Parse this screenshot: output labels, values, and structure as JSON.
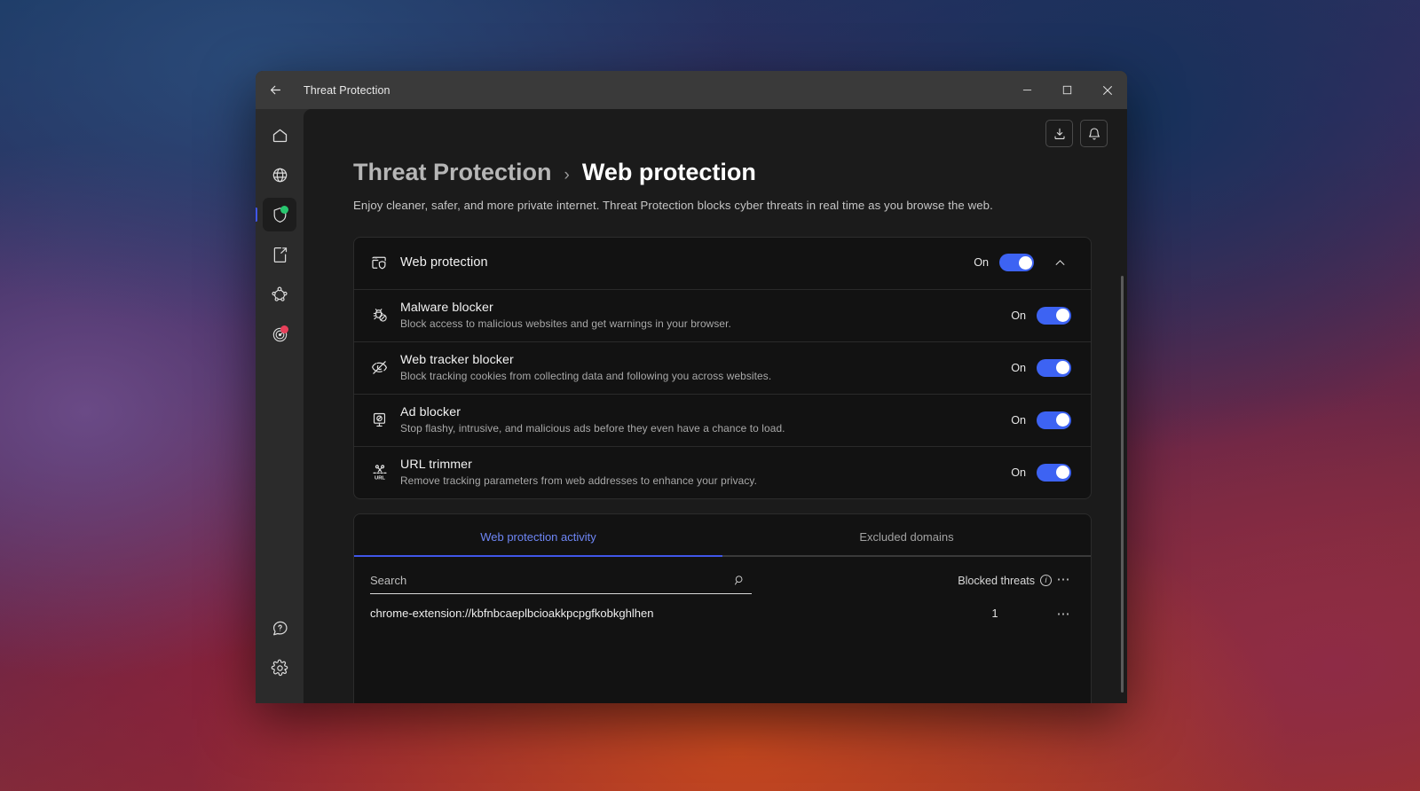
{
  "window": {
    "title": "Threat Protection",
    "back_icon": "arrow-left-icon",
    "minimize_label": "–",
    "maximize_label": "□",
    "close_label": "✕"
  },
  "rail": {
    "items": [
      {
        "name": "home",
        "icon": "home-icon",
        "active": false,
        "badge": ""
      },
      {
        "name": "vpn",
        "icon": "globe-icon",
        "active": false,
        "badge": ""
      },
      {
        "name": "threat-protection",
        "icon": "shield-icon",
        "active": true,
        "badge": "green"
      },
      {
        "name": "file-share",
        "icon": "file-share-icon",
        "active": false,
        "badge": ""
      },
      {
        "name": "meshnet",
        "icon": "meshnet-icon",
        "active": false,
        "badge": ""
      },
      {
        "name": "dark-web-monitor",
        "icon": "radar-icon",
        "active": false,
        "badge": "red"
      }
    ],
    "bottom_items": [
      {
        "name": "help",
        "icon": "help-icon"
      },
      {
        "name": "settings",
        "icon": "gear-icon"
      }
    ]
  },
  "top_actions": [
    {
      "name": "download-button",
      "icon": "download-icon"
    },
    {
      "name": "notifications-button",
      "icon": "bell-icon"
    }
  ],
  "header": {
    "breadcrumb_parent": "Threat Protection",
    "breadcrumb_separator": "›",
    "breadcrumb_current": "Web protection",
    "subtitle": "Enjoy cleaner, safer, and more private internet. Threat Protection blocks cyber threats in real time as you browse the web."
  },
  "master": {
    "icon": "browser-shield-icon",
    "title": "Web protection",
    "state_label": "On",
    "toggle_on": true,
    "collapse_icon": "chevron-up-icon"
  },
  "features": [
    {
      "icon": "bug-blocked-icon",
      "title": "Malware blocker",
      "description": "Block access to malicious websites and get warnings in your browser.",
      "state_label": "On",
      "toggle_on": true
    },
    {
      "icon": "eye-off-icon",
      "title": "Web tracker blocker",
      "description": "Block tracking cookies from collecting data and following you across websites.",
      "state_label": "On",
      "toggle_on": true
    },
    {
      "icon": "ad-blocked-icon",
      "title": "Ad blocker",
      "description": "Stop flashy, intrusive, and malicious ads before they even have a chance to load.",
      "state_label": "On",
      "toggle_on": true
    },
    {
      "icon": "url-scissors-icon",
      "title": "URL trimmer",
      "description": "Remove tracking parameters from web addresses to enhance your privacy.",
      "state_label": "On",
      "toggle_on": true
    }
  ],
  "activity": {
    "tabs": [
      {
        "label": "Web protection activity",
        "active": true
      },
      {
        "label": "Excluded domains",
        "active": false
      }
    ],
    "search": {
      "placeholder": "Search",
      "value": "",
      "icon": "search-icon"
    },
    "column_blocked_threats": "Blocked threats",
    "info_icon": "info-icon",
    "kebab_icon": "more-options-icon",
    "kebab_label": "⋯",
    "rows": [
      {
        "domain": "chrome-extension://kbfnbcaeplbcioakkpcpgfkobkghlhen",
        "blocked_threats": "1"
      }
    ]
  },
  "colors": {
    "accent_blue": "#3d63f3",
    "tab_active": "#6e86f5",
    "badge_green": "#28c76f",
    "badge_red": "#e8405a",
    "card_bg": "#121212",
    "content_bg": "#1b1b1b"
  }
}
